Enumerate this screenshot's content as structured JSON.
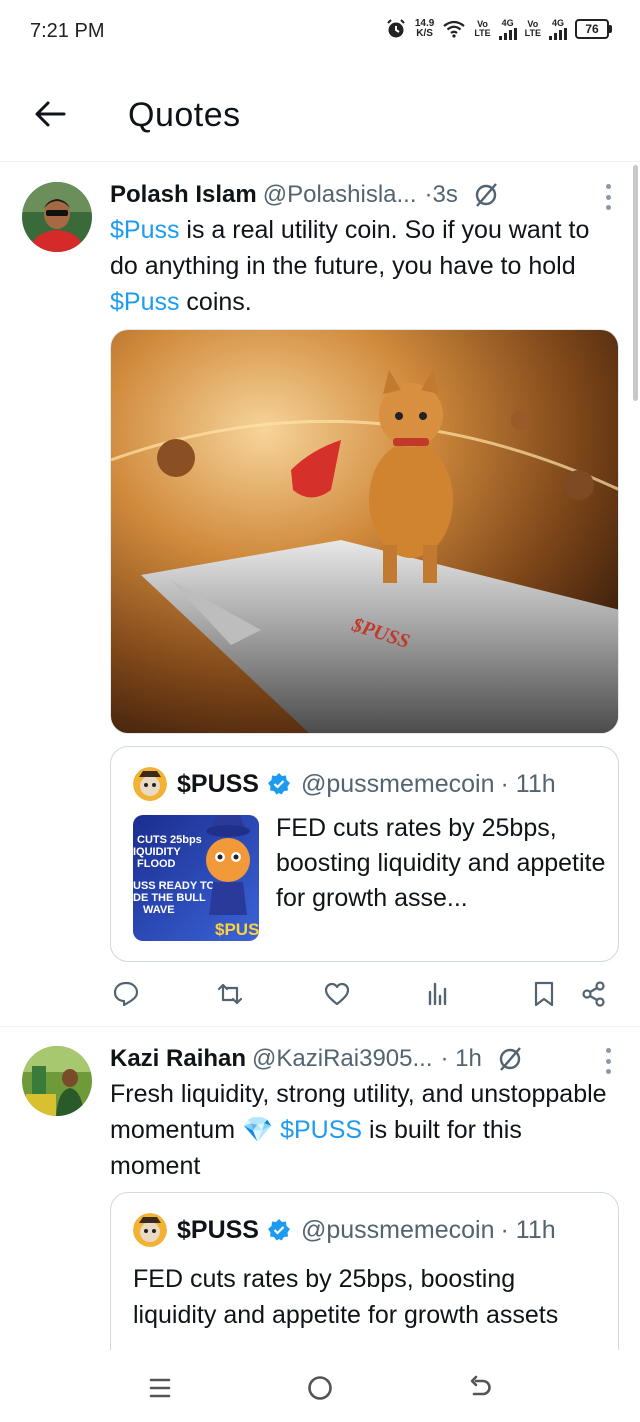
{
  "status_bar": {
    "time": "7:21 PM",
    "net_speed_value": "14.9",
    "net_speed_unit": "K/S",
    "sim1_label": "Vo\nLTE",
    "sim1_gen": "4G",
    "sim2_label": "Vo\nLTE",
    "sim2_gen": "4G",
    "battery": "76",
    "icons": [
      "alarm-icon",
      "wifi-icon",
      "signal-icon",
      "battery-icon"
    ]
  },
  "header": {
    "title": "Quotes",
    "back_icon": "arrow-left-icon"
  },
  "tweets": [
    {
      "name": "Polash Islam",
      "handle": "@Polashisla...",
      "time": "·3s",
      "text_parts": [
        "$Puss",
        " is a real utility coin. So if you want to do anything in the future, you have to hold ",
        "$Puss",
        " coins."
      ],
      "media_label": "$PUSS",
      "quote": {
        "name": "$PUSS",
        "handle": "@pussmemecoin",
        "time": "· 11h",
        "text": "FED cuts rates by 25bps, boosting liquidity and appetite for growth asse...",
        "thumb_lines": [
          "CUTS 25bps",
          "IQUIDITY",
          "FLOOD",
          "USS READY TO",
          "DE THE BULL",
          "WAVE"
        ],
        "thumb_brand": "$PUS"
      }
    },
    {
      "name": "Kazi Raihan",
      "handle": "@KaziRai3905...",
      "time": "· 1h",
      "text_parts": [
        "Fresh liquidity, strong utility, and unstoppable momentum ",
        "💎",
        " ",
        "$PUSS",
        " is built for this moment"
      ],
      "quote": {
        "name": "$PUSS",
        "handle": "@pussmemecoin",
        "time": "· 11h",
        "text": "FED cuts rates by 25bps, boosting liquidity and appetite for growth assets"
      }
    }
  ],
  "colors": {
    "accent": "#1d9bf0",
    "text": "#0f1419",
    "secondary": "#536471",
    "border": "#cfd9de"
  }
}
